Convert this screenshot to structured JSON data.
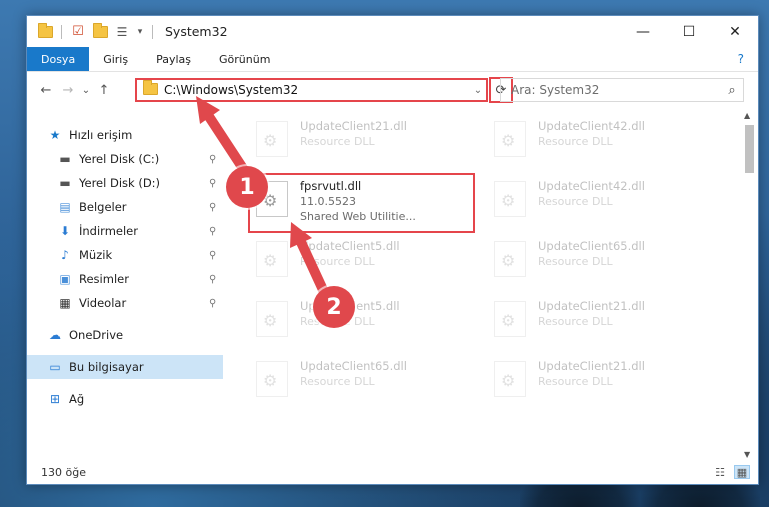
{
  "window": {
    "title": "System32",
    "minimize": "—",
    "maximize": "☐",
    "close": "✕"
  },
  "ribbon": {
    "tabs": [
      "Dosya",
      "Giriş",
      "Paylaş",
      "Görünüm"
    ],
    "help": "?"
  },
  "navbar": {
    "back": "←",
    "forward": "→",
    "recent": "⌄",
    "up": "↑",
    "address": "C:\\Windows\\System32",
    "address_dropdown": "⌄",
    "refresh": "⟳",
    "search_placeholder": "Ara: System32",
    "search_icon": "⌕"
  },
  "nav_pane": {
    "items": [
      {
        "label": "Hızlı erişim",
        "icon": "star-icon",
        "glyph": "★",
        "color": "#1979ca",
        "pinned": false
      },
      {
        "label": "Yerel Disk (C:)",
        "icon": "drive-icon",
        "glyph": "▬",
        "color": "#555555",
        "pinned": true
      },
      {
        "label": "Yerel Disk (D:)",
        "icon": "drive-icon",
        "glyph": "▬",
        "color": "#555555",
        "pinned": true
      },
      {
        "label": "Belgeler",
        "icon": "documents-icon",
        "glyph": "▤",
        "color": "#4a90d9",
        "pinned": true
      },
      {
        "label": "İndirmeler",
        "icon": "download-icon",
        "glyph": "⬇",
        "color": "#2b7cd3",
        "pinned": true
      },
      {
        "label": "Müzik",
        "icon": "music-icon",
        "glyph": "♪",
        "color": "#2b7cd3",
        "pinned": true
      },
      {
        "label": "Resimler",
        "icon": "pictures-icon",
        "glyph": "▣",
        "color": "#4a90d9",
        "pinned": true
      },
      {
        "label": "Videolar",
        "icon": "video-icon",
        "glyph": "▦",
        "color": "#333333",
        "pinned": true
      },
      {
        "label": "OneDrive",
        "icon": "cloud-icon",
        "glyph": "☁",
        "color": "#2b7cd3",
        "pinned": false
      },
      {
        "label": "Bu bilgisayar",
        "icon": "computer-icon",
        "glyph": "▭",
        "color": "#2b7cd3",
        "pinned": false
      },
      {
        "label": "Ağ",
        "icon": "network-icon",
        "glyph": "⊞",
        "color": "#2b7cd3",
        "pinned": false
      }
    ],
    "pin_glyph": "📌"
  },
  "files": {
    "left": [
      {
        "name": "UpdateClient21.dll",
        "sub": "Resource DLL"
      },
      {
        "name": "fpsrvutl.dll",
        "version": "11.0.5523",
        "sub": "Shared Web Utilitie..."
      },
      {
        "name": "UpdateClient5.dll",
        "sub": "Resource DLL"
      },
      {
        "name": "UpdateClient5.dll",
        "sub": "Resource DLL"
      },
      {
        "name": "UpdateClient65.dll",
        "sub": "Resource DLL"
      }
    ],
    "right": [
      {
        "name": "UpdateClient42.dll",
        "sub": "Resource DLL"
      },
      {
        "name": "UpdateClient42.dll",
        "sub": "Resource DLL"
      },
      {
        "name": "UpdateClient65.dll",
        "sub": "Resource DLL"
      },
      {
        "name": "UpdateClient21.dll",
        "sub": "Resource DLL"
      },
      {
        "name": "UpdateClient21.dll",
        "sub": "Resource DLL"
      }
    ]
  },
  "status": {
    "count": "130 öğe"
  },
  "annotations": {
    "badge1": "1",
    "badge2": "2",
    "highlight_color": "#e5454b"
  }
}
